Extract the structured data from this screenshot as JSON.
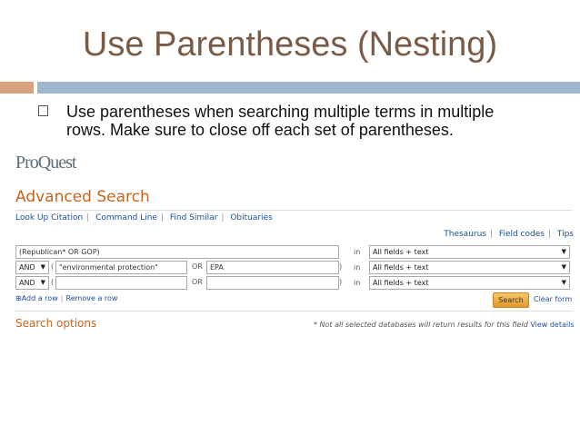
{
  "slide": {
    "title": "Use Parentheses (Nesting)",
    "bullet_line1": "Use parentheses when searching multiple terms in multiple",
    "bullet_line2": "rows. Make sure to close off each set of parentheses."
  },
  "proquest": {
    "logo": "ProQuest",
    "heading": "Advanced Search",
    "nav": [
      "Look Up Citation",
      "Command Line",
      "Find Similar",
      "Obituaries"
    ],
    "right_links": [
      "Thesaurus",
      "Field codes",
      "Tips"
    ],
    "rows": [
      {
        "op": "",
        "open": "",
        "term1": "(Republican* OR GOP)",
        "or": "",
        "term2": "",
        "close": "",
        "in": "in",
        "field": "All fields + text"
      },
      {
        "op": "AND",
        "open": "(",
        "term1": "\"environmental protection\"",
        "or": "OR",
        "term2": "EPA",
        "close": ")",
        "in": "in",
        "field": "All fields + text"
      },
      {
        "op": "AND",
        "open": "(",
        "term1": "",
        "or": "OR",
        "term2": "",
        "close": ")",
        "in": "in",
        "field": "All fields + text"
      }
    ],
    "add_row": "Add a row",
    "remove_row": "Remove a row",
    "search_button": "Search",
    "clear_form": "Clear form",
    "options_heading": "Search options",
    "note": "* Not all selected databases will return results for this field",
    "view_details": "View details"
  }
}
